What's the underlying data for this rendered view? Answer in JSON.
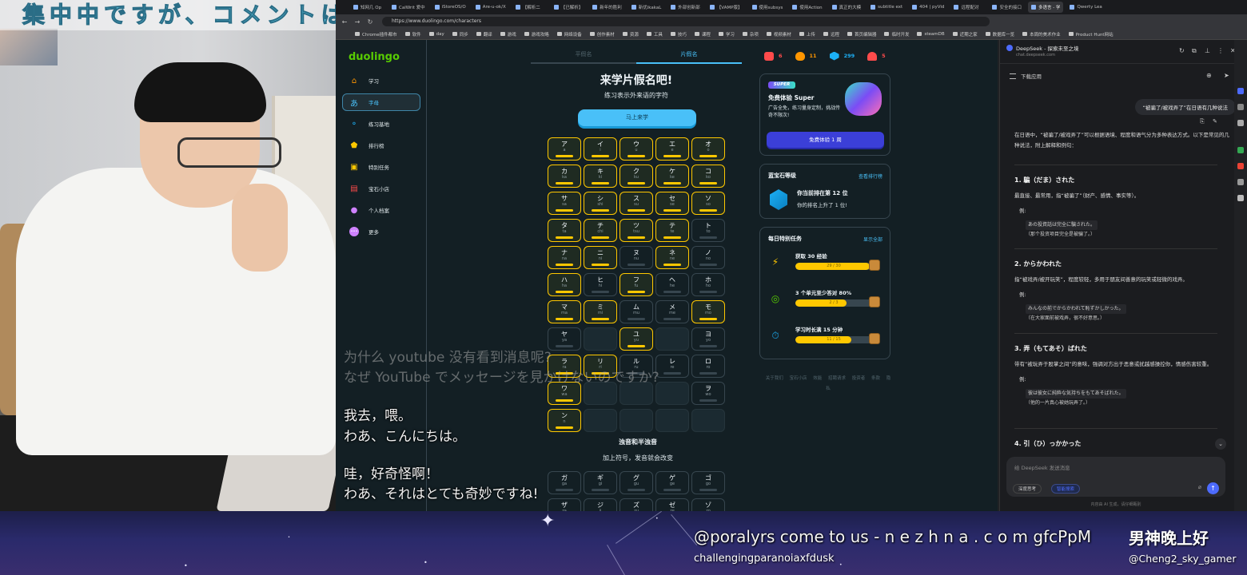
{
  "webcam": {
    "banner": "集中中ですが、コメントは"
  },
  "subtitles": {
    "line1_zh": "为什么 youtube 没有看到消息呢?",
    "line1_ja": "なぜ YouTube でメッセージを見かけないのですか?",
    "line2_zh": "我去，喂。",
    "line2_ja": "わあ、こんにちは。",
    "line3_zh": "哇，好奇怪啊！",
    "line3_ja": "わあ、それはとても奇妙ですね!"
  },
  "browser": {
    "tabs": [
      "知网几 Op",
      "CalWrit 爱中",
      "iStoreOS/O",
      "Are-u-ok/X",
      "【解析二",
      "【已解析】",
      "新年的胜利",
      "新优ikakaL",
      "外部创新部",
      "【VAMP版】",
      "使用subsys",
      "使用Action",
      "真正的大模",
      "subtitle ext",
      "404 | pyVid",
      "远程配对",
      "安全的接口",
      "多语言 - 学",
      "Qwerty Lea"
    ],
    "active_tab_index": 17,
    "url": "https://www.duolingo.com/characters",
    "bookmarks": [
      "Chrome插件都市",
      "软件",
      "day",
      "同步",
      "翻译",
      "游戏",
      "游戏攻略",
      "网络设备",
      "创作素材",
      "资源",
      "工具",
      "技巧",
      "课程",
      "学习",
      "杂项",
      "视频素材",
      "上传",
      "远程",
      "首页编辑器",
      "临时开发",
      "steamDB",
      "近期之家",
      "数据库一览",
      "本周的美术作业",
      "Product Hunt网站"
    ]
  },
  "duolingo": {
    "logo": "duolingo",
    "sidebar": [
      {
        "label": "学习",
        "icon": "home-icon",
        "color": "#ff9600"
      },
      {
        "label": "字母",
        "icon": "kana-icon",
        "color": "#49c0f8",
        "active": true
      },
      {
        "label": "练习基地",
        "icon": "dumbbell-icon",
        "color": "#1cb0f6"
      },
      {
        "label": "排行榜",
        "icon": "shield-icon",
        "color": "#ffc800"
      },
      {
        "label": "特别任务",
        "icon": "chest-icon",
        "color": "#ffc800"
      },
      {
        "label": "宝石小店",
        "icon": "shop-icon",
        "color": "#ff4b4b"
      },
      {
        "label": "个人档案",
        "icon": "avatar-icon",
        "color": "#ce82ff"
      },
      {
        "label": "更多",
        "icon": "more-icon",
        "color": "#ce82ff"
      }
    ],
    "mode_tabs": [
      "平假名",
      "片假名"
    ],
    "active_mode": 1,
    "title": "来学片假名吧!",
    "subtitle": "练习表示外来语的字符",
    "learn_button": "马上来学",
    "kana_rows": [
      [
        [
          "ア",
          "a",
          1
        ],
        [
          "イ",
          "i",
          1
        ],
        [
          "ウ",
          "u",
          1
        ],
        [
          "エ",
          "e",
          1
        ],
        [
          "オ",
          "o",
          1
        ]
      ],
      [
        [
          "カ",
          "ka",
          1
        ],
        [
          "キ",
          "ki",
          1
        ],
        [
          "ク",
          "ku",
          1
        ],
        [
          "ケ",
          "ke",
          1
        ],
        [
          "コ",
          "ko",
          1
        ]
      ],
      [
        [
          "サ",
          "sa",
          1
        ],
        [
          "シ",
          "shi",
          1
        ],
        [
          "ス",
          "su",
          1
        ],
        [
          "セ",
          "se",
          1
        ],
        [
          "ソ",
          "so",
          1
        ]
      ],
      [
        [
          "タ",
          "ta",
          1
        ],
        [
          "チ",
          "chi",
          1
        ],
        [
          "ツ",
          "tsu",
          1
        ],
        [
          "テ",
          "te",
          1
        ],
        [
          "ト",
          "to",
          0
        ]
      ],
      [
        [
          "ナ",
          "na",
          1
        ],
        [
          "ニ",
          "ni",
          1
        ],
        [
          "ヌ",
          "nu",
          0
        ],
        [
          "ネ",
          "ne",
          1
        ],
        [
          "ノ",
          "no",
          0
        ]
      ],
      [
        [
          "ハ",
          "ha",
          1
        ],
        [
          "ヒ",
          "hi",
          0
        ],
        [
          "フ",
          "fu",
          1
        ],
        [
          "ヘ",
          "he",
          0
        ],
        [
          "ホ",
          "ho",
          0
        ]
      ],
      [
        [
          "マ",
          "ma",
          1
        ],
        [
          "ミ",
          "mi",
          1
        ],
        [
          "ム",
          "mu",
          0
        ],
        [
          "メ",
          "me",
          0
        ],
        [
          "モ",
          "mo",
          1
        ]
      ],
      [
        [
          "ヤ",
          "ya",
          0
        ],
        [
          "",
          "",
          -1
        ],
        [
          "ユ",
          "yu",
          1
        ],
        [
          "",
          "",
          -1
        ],
        [
          "ヨ",
          "yo",
          0
        ]
      ],
      [
        [
          "ラ",
          "ra",
          1
        ],
        [
          "リ",
          "ri",
          1
        ],
        [
          "ル",
          "ru",
          0
        ],
        [
          "レ",
          "re",
          0
        ],
        [
          "ロ",
          "ro",
          0
        ]
      ],
      [
        [
          "ワ",
          "wa",
          1
        ],
        [
          "",
          "",
          -1
        ],
        [
          "",
          "",
          -1
        ],
        [
          "",
          "",
          -1
        ],
        [
          "ヲ",
          "wo",
          0
        ]
      ],
      [
        [
          "ン",
          "n",
          1
        ],
        [
          "",
          "",
          -1
        ],
        [
          "",
          "",
          -1
        ],
        [
          "",
          "",
          -1
        ],
        [
          "",
          "",
          -1
        ]
      ]
    ],
    "dakuten_title": "浊音和半浊音",
    "dakuten_sub": "加上符号，发音就会改变",
    "dakuten_rows": [
      [
        [
          "ガ",
          "ga",
          0
        ],
        [
          "ギ",
          "gi",
          0
        ],
        [
          "グ",
          "gu",
          0
        ],
        [
          "ゲ",
          "ge",
          0
        ],
        [
          "ゴ",
          "go",
          0
        ]
      ],
      [
        [
          "ザ",
          "za",
          0
        ],
        [
          "ジ",
          "ji",
          0
        ],
        [
          "ズ",
          "zu",
          0
        ],
        [
          "ゼ",
          "ze",
          0
        ],
        [
          "ゾ",
          "zo",
          0
        ]
      ]
    ],
    "stats": [
      {
        "value": "6",
        "color": "#ff4b4b",
        "icon": "flag-icon"
      },
      {
        "value": "11",
        "color": "#ff9600",
        "icon": "streak-icon"
      },
      {
        "value": "299",
        "color": "#1cb0f6",
        "icon": "gem-icon"
      },
      {
        "value": "5",
        "color": "#ff4b4b",
        "icon": "heart-icon"
      }
    ],
    "super": {
      "badge": "SUPER",
      "title": "免费体验 Super",
      "desc": "广告全免，练习量身定制，挑战传奇不限次!",
      "button": "免费体验 1 周"
    },
    "league": {
      "title": "蓝宝石等级",
      "link": "查看排行榜",
      "line1": "你当前排在第 12 位",
      "line2": "你的排名上升了 1 位!"
    },
    "quests": {
      "title": "每日特别任务",
      "link": "显示全部",
      "items": [
        {
          "text": "获取 30 经验",
          "progress": "29 / 30",
          "fraction": 0.97,
          "icon_color": "#ffc800",
          "icon": "lightning-icon"
        },
        {
          "text": "3 个单元至少答对 80%",
          "progress": "2 / 3",
          "fraction": 0.67,
          "icon_color": "#58cc02",
          "icon": "target-icon"
        },
        {
          "text": "学习时长满 15 分钟",
          "progress": "11 / 15",
          "fraction": 0.73,
          "icon_color": "#1cb0f6",
          "icon": "timer-icon"
        }
      ]
    },
    "footer": "关于我们 宝石小店 效能 招聘请求 投资者 条款 隐私"
  },
  "deepseek": {
    "title": "DeepSeek - 探索未至之境",
    "url": "chat.deepseek.com",
    "download": "下载应用",
    "question": "“被骗了/被戏弄了”在日语有几种说法",
    "intro": "在日语中，“被骗了/被戏弄了”可以根据语境、程度和语气分为多种表达方式。以下是常见的几种说法，附上解释和例句：",
    "sections": [
      {
        "heading": "1. 騙（だま）された",
        "desc": "最直接、最常用，指“被骗了”（财产、感情、事实等）。",
        "bullet": "例:",
        "ex_jp": "あの投資話は完全に騙された。",
        "ex_zh": "（那个投资项目完全是被骗了。）"
      },
      {
        "heading": "2. からかわれた",
        "desc": "指“被戏弄/被开玩笑”，程度较轻，多用于朋友间善意的玩笑或轻微的戏弄。",
        "bullet": "例:",
        "ex_jp": "みんなの前でからかわれて恥ずかしかった。",
        "ex_zh": "（在大家面前被戏弄，很不好意思。）"
      },
      {
        "heading": "3. 弄（もてあそ）ばれた",
        "desc": "带有“被玩弄于股掌之间”的意味，强调对方出于恶意或扰越感操控你，情感伤害较重。",
        "bullet": "例:",
        "ex_jp": "彼は彼女に純粋な気持ちをもてあそばれた。",
        "ex_zh": "（他的一片真心被她玩弄了。）"
      },
      {
        "heading": "4. 引（ひ）っかかった",
        "desc": "",
        "bullet": "",
        "ex_jp": "",
        "ex_zh": ""
      }
    ],
    "input_placeholder": "给 DeepSeek 发送消息",
    "pill_think": "深度思考",
    "pill_search": "智能搜索",
    "footer": "内容由 AI 生成，请仔细甄别"
  },
  "overlay": {
    "ticker": "@poralyrs come to us - n e z h n a . c o m gfcPpM",
    "ticker_sub": "challengingparanoiaxfdusk",
    "right_title": "男神晚上好",
    "handle": "@Cheng2_sky_gamer"
  }
}
